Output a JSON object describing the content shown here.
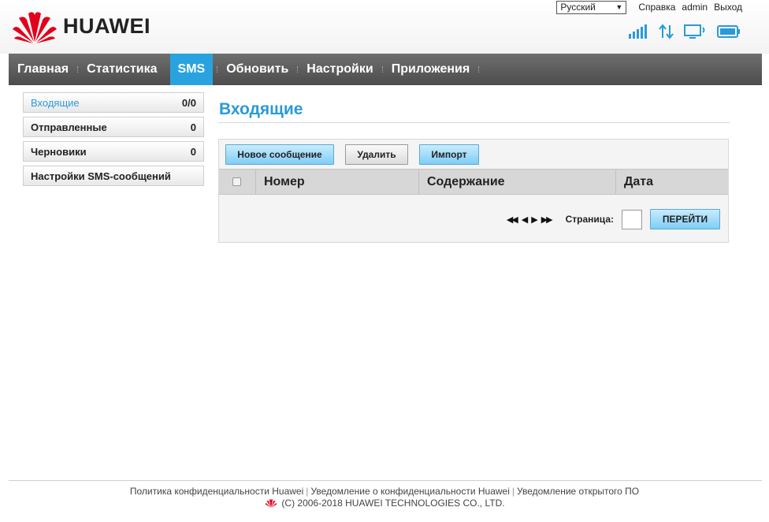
{
  "header": {
    "brand": "HUAWEI",
    "language": "Русский",
    "help": "Справка",
    "user": "admin",
    "logout": "Выход"
  },
  "status_icons": [
    "signal-bars-icon",
    "data-transfer-icon",
    "device-connected-icon",
    "battery-icon"
  ],
  "colors": {
    "accent": "#29a3e0",
    "nav_bg": "#555555",
    "title": "#2a9ad6"
  },
  "nav": {
    "items": [
      {
        "label": "Главная"
      },
      {
        "label": "Статистика"
      },
      {
        "label": "SMS",
        "active": true
      },
      {
        "label": "Обновить"
      },
      {
        "label": "Настройки"
      },
      {
        "label": "Приложения"
      }
    ]
  },
  "sidebar": {
    "items": [
      {
        "label": "Входящие",
        "count": "0/0",
        "active": true
      },
      {
        "label": "Отправленные",
        "count": "0"
      },
      {
        "label": "Черновики",
        "count": "0"
      },
      {
        "label": "Настройки SMS-сообщений",
        "count": ""
      }
    ]
  },
  "main": {
    "title": "Входящие",
    "toolbar": {
      "new_message": "Новое сообщение",
      "delete": "Удалить",
      "import": "Импорт"
    },
    "table": {
      "columns": [
        "Номер",
        "Содержание",
        "Дата"
      ]
    },
    "pager": {
      "page_label": "Страница:",
      "go_button": "ПЕРЕЙТИ",
      "first": "◀◀",
      "prev": "◀",
      "next": "▶",
      "last": "▶▶"
    }
  },
  "footer": {
    "privacy_policy": "Политика конфиденциальности Huawei",
    "privacy_notice": "Уведомление о конфиденциальности Huawei",
    "open_source": "Уведомление открытого ПО",
    "copyright": "(C) 2006-2018 HUAWEI TECHNOLOGIES CO., LTD."
  }
}
